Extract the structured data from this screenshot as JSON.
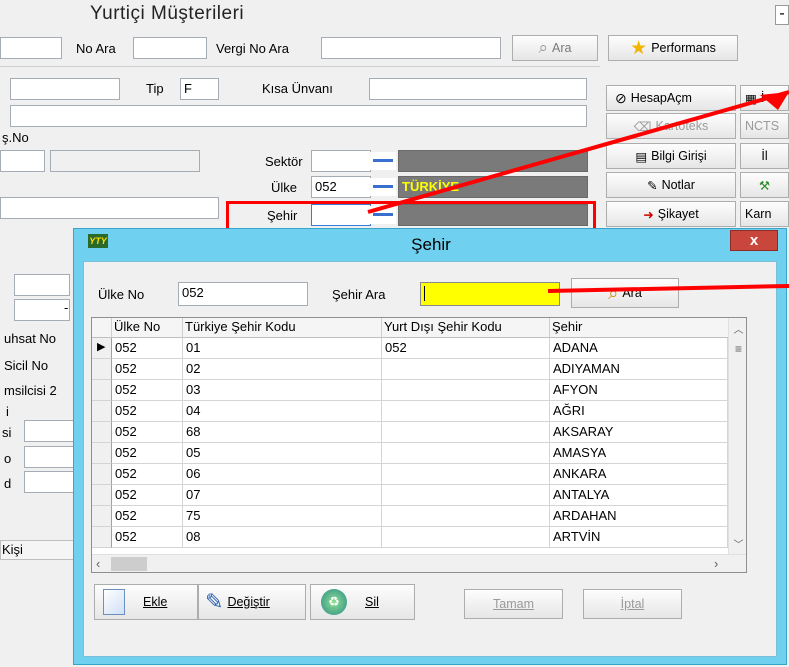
{
  "window": {
    "title": "Yurtiçi Müşterileri",
    "minimize_glyph": "-"
  },
  "search_bar": {
    "no_label": "No Ara",
    "vergi_label": "Vergi No Ara",
    "ara_button": "Ara",
    "performance_button": "Performans"
  },
  "form": {
    "tip_label": "Tip",
    "tip_value": "F",
    "kisa_unvan_label": "Kısa Ünvanı",
    "no_partial_label": "ş.No",
    "sektor_label": "Sektör",
    "ulke_label": "Ülke",
    "ulke_value": "052",
    "ulke_name": "TÜRKİYE",
    "sehir_label": "Şehir",
    "ruhsat_label": "uhsat No",
    "sicil_label": "Sicil No",
    "temsilci_label": "msilcisi 2",
    "partial_i": "i",
    "partial_si": "si",
    "partial_o": "o",
    "partial_d": "d",
    "kisi_label": "Kişi",
    "minus_glyph": "-"
  },
  "side_buttons": {
    "hesap": "HesapAçm",
    "kartoteks": "Kartoteks",
    "ncts": "NCTS",
    "bilgi": "Bilgi Girişi",
    "notlar": "Notlar",
    "sikayet": "Şikayet",
    "i_partial": "İ",
    "il_partial": "İl",
    "kar_partial": "Karn"
  },
  "dialog": {
    "title": "Şehir",
    "close": "x",
    "ulke_no_label": "Ülke No",
    "ulke_no_value": "052",
    "sehir_ara_label": "Şehir Ara",
    "ara_button": "Ara",
    "columns": [
      "Ülke No",
      "Türkiye Şehir Kodu",
      "Yurt Dışı Şehir Kodu",
      "Şehir"
    ],
    "rows": [
      [
        "052",
        "01",
        "052",
        "ADANA"
      ],
      [
        "052",
        "02",
        "",
        "ADIYAMAN"
      ],
      [
        "052",
        "03",
        "",
        "AFYON"
      ],
      [
        "052",
        "04",
        "",
        "AĞRI"
      ],
      [
        "052",
        "68",
        "",
        "AKSARAY"
      ],
      [
        "052",
        "05",
        "",
        "AMASYA"
      ],
      [
        "052",
        "06",
        "",
        "ANKARA"
      ],
      [
        "052",
        "07",
        "",
        "ANTALYA"
      ],
      [
        "052",
        "75",
        "",
        "ARDAHAN"
      ],
      [
        "052",
        "08",
        "",
        "ARTVİN"
      ]
    ],
    "buttons": {
      "ekle": "Ekle",
      "degistir": "Değiştir",
      "sil": "Sil",
      "tamam": "Tamam",
      "iptal": "İptal"
    }
  },
  "colors": {
    "highlight": "#ff0000",
    "search_field": "#ffff00",
    "dialog_frame": "#6fd0ef",
    "turkiye_bg": "#7a7a7a",
    "turkiye_text": "#ffff00"
  }
}
